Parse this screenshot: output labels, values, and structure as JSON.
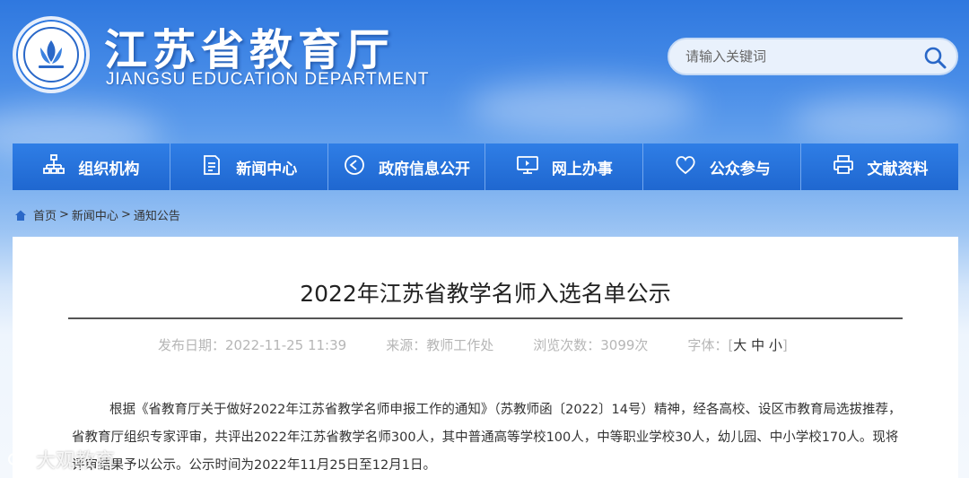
{
  "header": {
    "site_title": "江苏省教育厅",
    "site_subtitle": "JIANGSU EDUCATION DEPARTMENT",
    "logo": "jiangsu-education-logo"
  },
  "search": {
    "placeholder": "请输入关键词",
    "icon": "search-icon"
  },
  "nav": {
    "items": [
      {
        "label": "组织机构",
        "icon": "org-chart-icon"
      },
      {
        "label": "新闻中心",
        "icon": "document-icon"
      },
      {
        "label": "政府信息公开",
        "icon": "circle-play-icon"
      },
      {
        "label": "网上办事",
        "icon": "monitor-icon"
      },
      {
        "label": "公众参与",
        "icon": "heart-icon"
      },
      {
        "label": "文献资料",
        "icon": "printer-icon"
      }
    ]
  },
  "breadcrumb": {
    "home": "首页",
    "sep": ">",
    "level2": "新闻中心",
    "level3": "通知公告"
  },
  "article": {
    "title": "2022年江苏省教学名师入选名单公示",
    "meta": {
      "date_label": "发布日期：",
      "date_value": "2022-11-25 11:39",
      "source_label": "来源：",
      "source_value": "教师工作处",
      "views_label": "浏览次数：",
      "views_value": "3099次",
      "font_label": "字体：",
      "font_large": "大",
      "font_medium": "中",
      "font_small": "小"
    },
    "body": "根据《省教育厅关于做好2022年江苏省教学名师申报工作的通知》（苏教师函〔2022〕14号）精神，经各高校、设区市教育局选拔推荐，省教育厅组织专家评审，共评出2022年江苏省教学名师300人，其中普通高等学校100人，中等职业学校30人，幼儿园、中小学校170人。现将评审结果予以公示。公示时间为2022年11月25日至12月1日。"
  },
  "watermark": {
    "text": "大观教育"
  },
  "colors": {
    "nav_bg": "#1f67d0",
    "header_sky": "#2f78df",
    "title_text": "#222222",
    "meta_text": "#b6b6b6"
  }
}
